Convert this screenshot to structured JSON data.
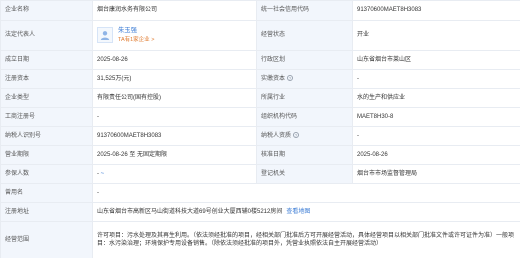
{
  "rows": {
    "r1": {
      "l1": "企业名称",
      "v1": "烟台康润水务有限公司",
      "l2": "统一社会信用代码",
      "v2": "91370600MAET8H3083"
    },
    "r2": {
      "l1": "法定代表人",
      "name": "朱玉强",
      "sub": "TA有1家企业",
      "sub_arrow": ">",
      "l2": "经营状态",
      "v2": "开业"
    },
    "r3": {
      "l1": "成立日期",
      "v1": "2025-08-26",
      "l2": "行政区划",
      "v2": "山东省烟台市莱山区"
    },
    "r4": {
      "l1": "注册资本",
      "v1": "31,525万(元)",
      "l2": "实缴资本",
      "v2": "-"
    },
    "r5": {
      "l1": "企业类型",
      "v1": "有限责任公司(国有控股)",
      "l2": "所属行业",
      "v2": "水的生产和供应业"
    },
    "r6": {
      "l1": "工商注册号",
      "v1": "-",
      "l2": "组织机构代码",
      "v2": "MAET8H30-8"
    },
    "r7": {
      "l1": "纳税人识别号",
      "v1": "91370600MAET8H3083",
      "l2": "纳税人资质",
      "v2": "-"
    },
    "r8": {
      "l1": "营业期限",
      "v1": "2025-08-26 至 无固定期限",
      "l2": "核准日期",
      "v2": "2025-08-26"
    },
    "r9": {
      "l1": "参保人数",
      "v1": "-",
      "v1b": "~",
      "l2": "登记机关",
      "v2": "烟台市市场监督管理局"
    },
    "r10": {
      "l1": "曾用名",
      "v1": "-"
    },
    "r11": {
      "l1": "注册地址",
      "v1": "山东省烟台市高新区马山街道科技大道69号创业大厦西辅0楼5212房间",
      "link": "查看地图"
    },
    "r12": {
      "l1": "经营范围",
      "v1": "许可项目：污水处理及其再生利用。（依法须经批准的项目，经相关部门批准后方可开展经营活动，具体经营项目以相关部门批准文件或许可证件为准）一般项目：水污染治理；环境保护专用设备销售。（除依法须经批准的项目外，凭营业执照依法自主开展经营活动）"
    }
  },
  "colors": {
    "label_bg": "#f2f6fc",
    "border": "#e8ecf2",
    "link": "#3a7bd5",
    "accent_orange": "#e07a2e"
  },
  "icons": {
    "avatar": "person-avatar-icon",
    "help": "question-circle-icon"
  }
}
